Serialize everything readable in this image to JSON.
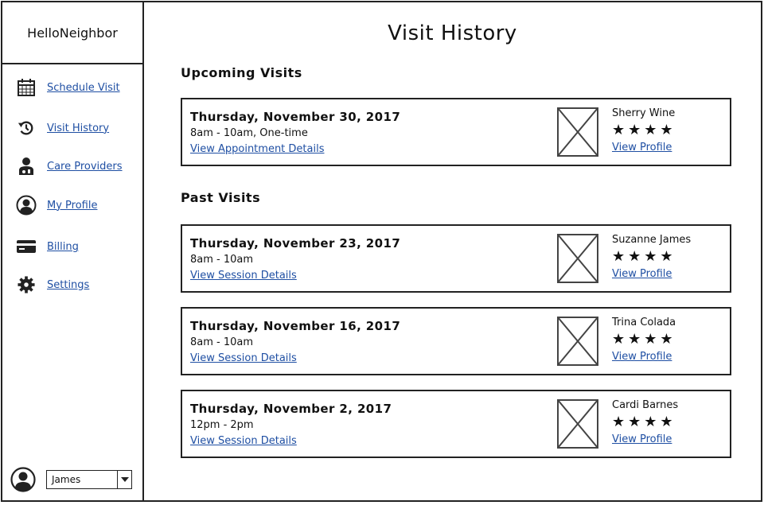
{
  "app": {
    "brand": "HelloNeighbor"
  },
  "sidebar": {
    "items": [
      {
        "label": "Schedule Visit",
        "icon": "calendar-icon"
      },
      {
        "label": "Visit History",
        "icon": "history-icon"
      },
      {
        "label": "Care Providers",
        "icon": "care-provider-icon"
      },
      {
        "label": "My Profile",
        "icon": "user-circle-icon"
      },
      {
        "label": "Billing",
        "icon": "credit-card-icon"
      },
      {
        "label": "Settings",
        "icon": "gear-icon"
      }
    ],
    "user": {
      "name": "James"
    }
  },
  "main": {
    "title": "Visit History",
    "upcoming_heading": "Upcoming Visits",
    "past_heading": "Past Visits",
    "upcoming": [
      {
        "date": "Thursday, November 30, 2017",
        "time": "8am - 10am, One-time",
        "link": "View Appointment Details",
        "provider": "Sherry Wine",
        "stars": "★★★★",
        "profile_link": "View Profile"
      }
    ],
    "past": [
      {
        "date": "Thursday, November 23, 2017",
        "time": "8am - 10am",
        "link": "View Session Details",
        "provider": "Suzanne James",
        "stars": "★★★★",
        "profile_link": "View Profile"
      },
      {
        "date": "Thursday, November 16, 2017",
        "time": "8am - 10am",
        "link": "View Session Details",
        "provider": "Trina Colada",
        "stars": "★★★★",
        "profile_link": "View Profile"
      },
      {
        "date": "Thursday, November 2, 2017",
        "time": "12pm - 2pm",
        "link": "View Session Details",
        "provider": "Cardi Barnes",
        "stars": "★★★★",
        "profile_link": "View Profile"
      }
    ]
  },
  "colors": {
    "link": "#1f4fa3",
    "border": "#222222"
  }
}
